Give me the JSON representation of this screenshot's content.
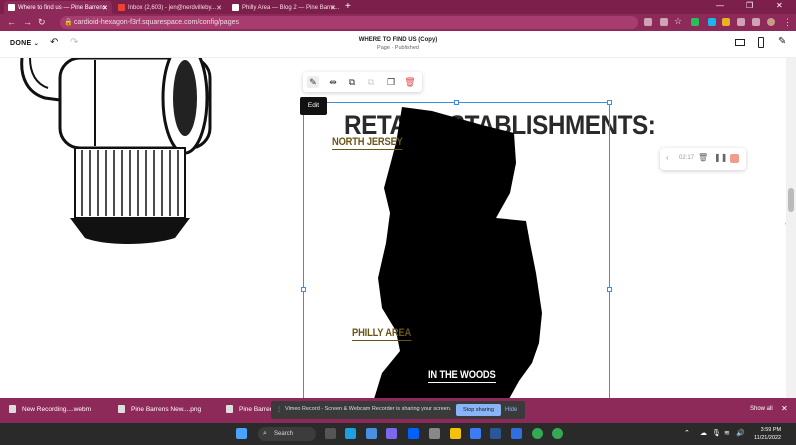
{
  "browser": {
    "tabs": [
      {
        "title": "Where to find us — Pine Barrens",
        "active": true
      },
      {
        "title": "Inbox (2,603) - jen@nerdvilleby...",
        "active": false
      },
      {
        "title": "Philly Area — Blog 2 — Pine Barre...",
        "active": false
      }
    ],
    "new_tab": "+",
    "url": "cardioid-hexagon-f3rf.squarespace.com/config/pages"
  },
  "editor": {
    "done_label": "DONE",
    "page_title": "WHERE TO FIND US (Copy)",
    "page_status": "Page · Published"
  },
  "content": {
    "heading": "RETAIL ESTABLISHMENTS:",
    "tooltip": "Edit",
    "map_labels": {
      "north_jersey": "NORTH JERSEY",
      "philly_area": "PHILLY AREA",
      "in_the_woods": "IN THE WOODS"
    },
    "colors": {
      "label_gold": "#6b5416",
      "map_fill": "#000000",
      "selection": "#3e8ee0"
    }
  },
  "recorder": {
    "time": "02:17"
  },
  "downloads": {
    "items": [
      {
        "name": "New Recording....webm"
      },
      {
        "name": "Pine Barrens New....png"
      },
      {
        "name": "Pine Barrens"
      }
    ],
    "show_all": "Show all",
    "share_message": "Vimeo Record - Screen & Webcam Recorder is sharing your screen.",
    "stop_label": "Stop sharing",
    "hide_label": "Hide"
  },
  "taskbar": {
    "search_label": "Search",
    "time": "3:59 PM",
    "date": "11/21/2022"
  }
}
